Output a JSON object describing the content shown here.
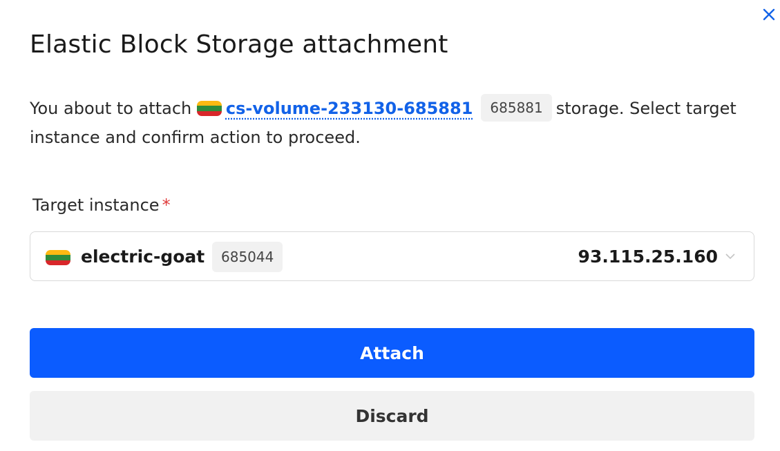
{
  "dialog": {
    "title": "Elastic Block Storage attachment",
    "close_icon": "close-icon",
    "description": {
      "prefix": "You about to attach",
      "volume_name": "cs-volume-233130-685881",
      "volume_id": "685881",
      "suffix": "storage. Select target instance and confirm action to proceed."
    }
  },
  "form": {
    "target_instance": {
      "label": "Target instance",
      "required_mark": "*",
      "selected": {
        "flag_icon": "lithuania-flag-icon",
        "name": "electric-goat",
        "id": "685044",
        "ip": "93.115.25.160"
      }
    }
  },
  "actions": {
    "attach_label": "Attach",
    "discard_label": "Discard"
  },
  "colors": {
    "primary": "#0b5cff",
    "link": "#1262e8",
    "required": "#e03c3c",
    "chip_bg": "#f1f1f1",
    "secondary_bg": "#f1f1f1"
  }
}
